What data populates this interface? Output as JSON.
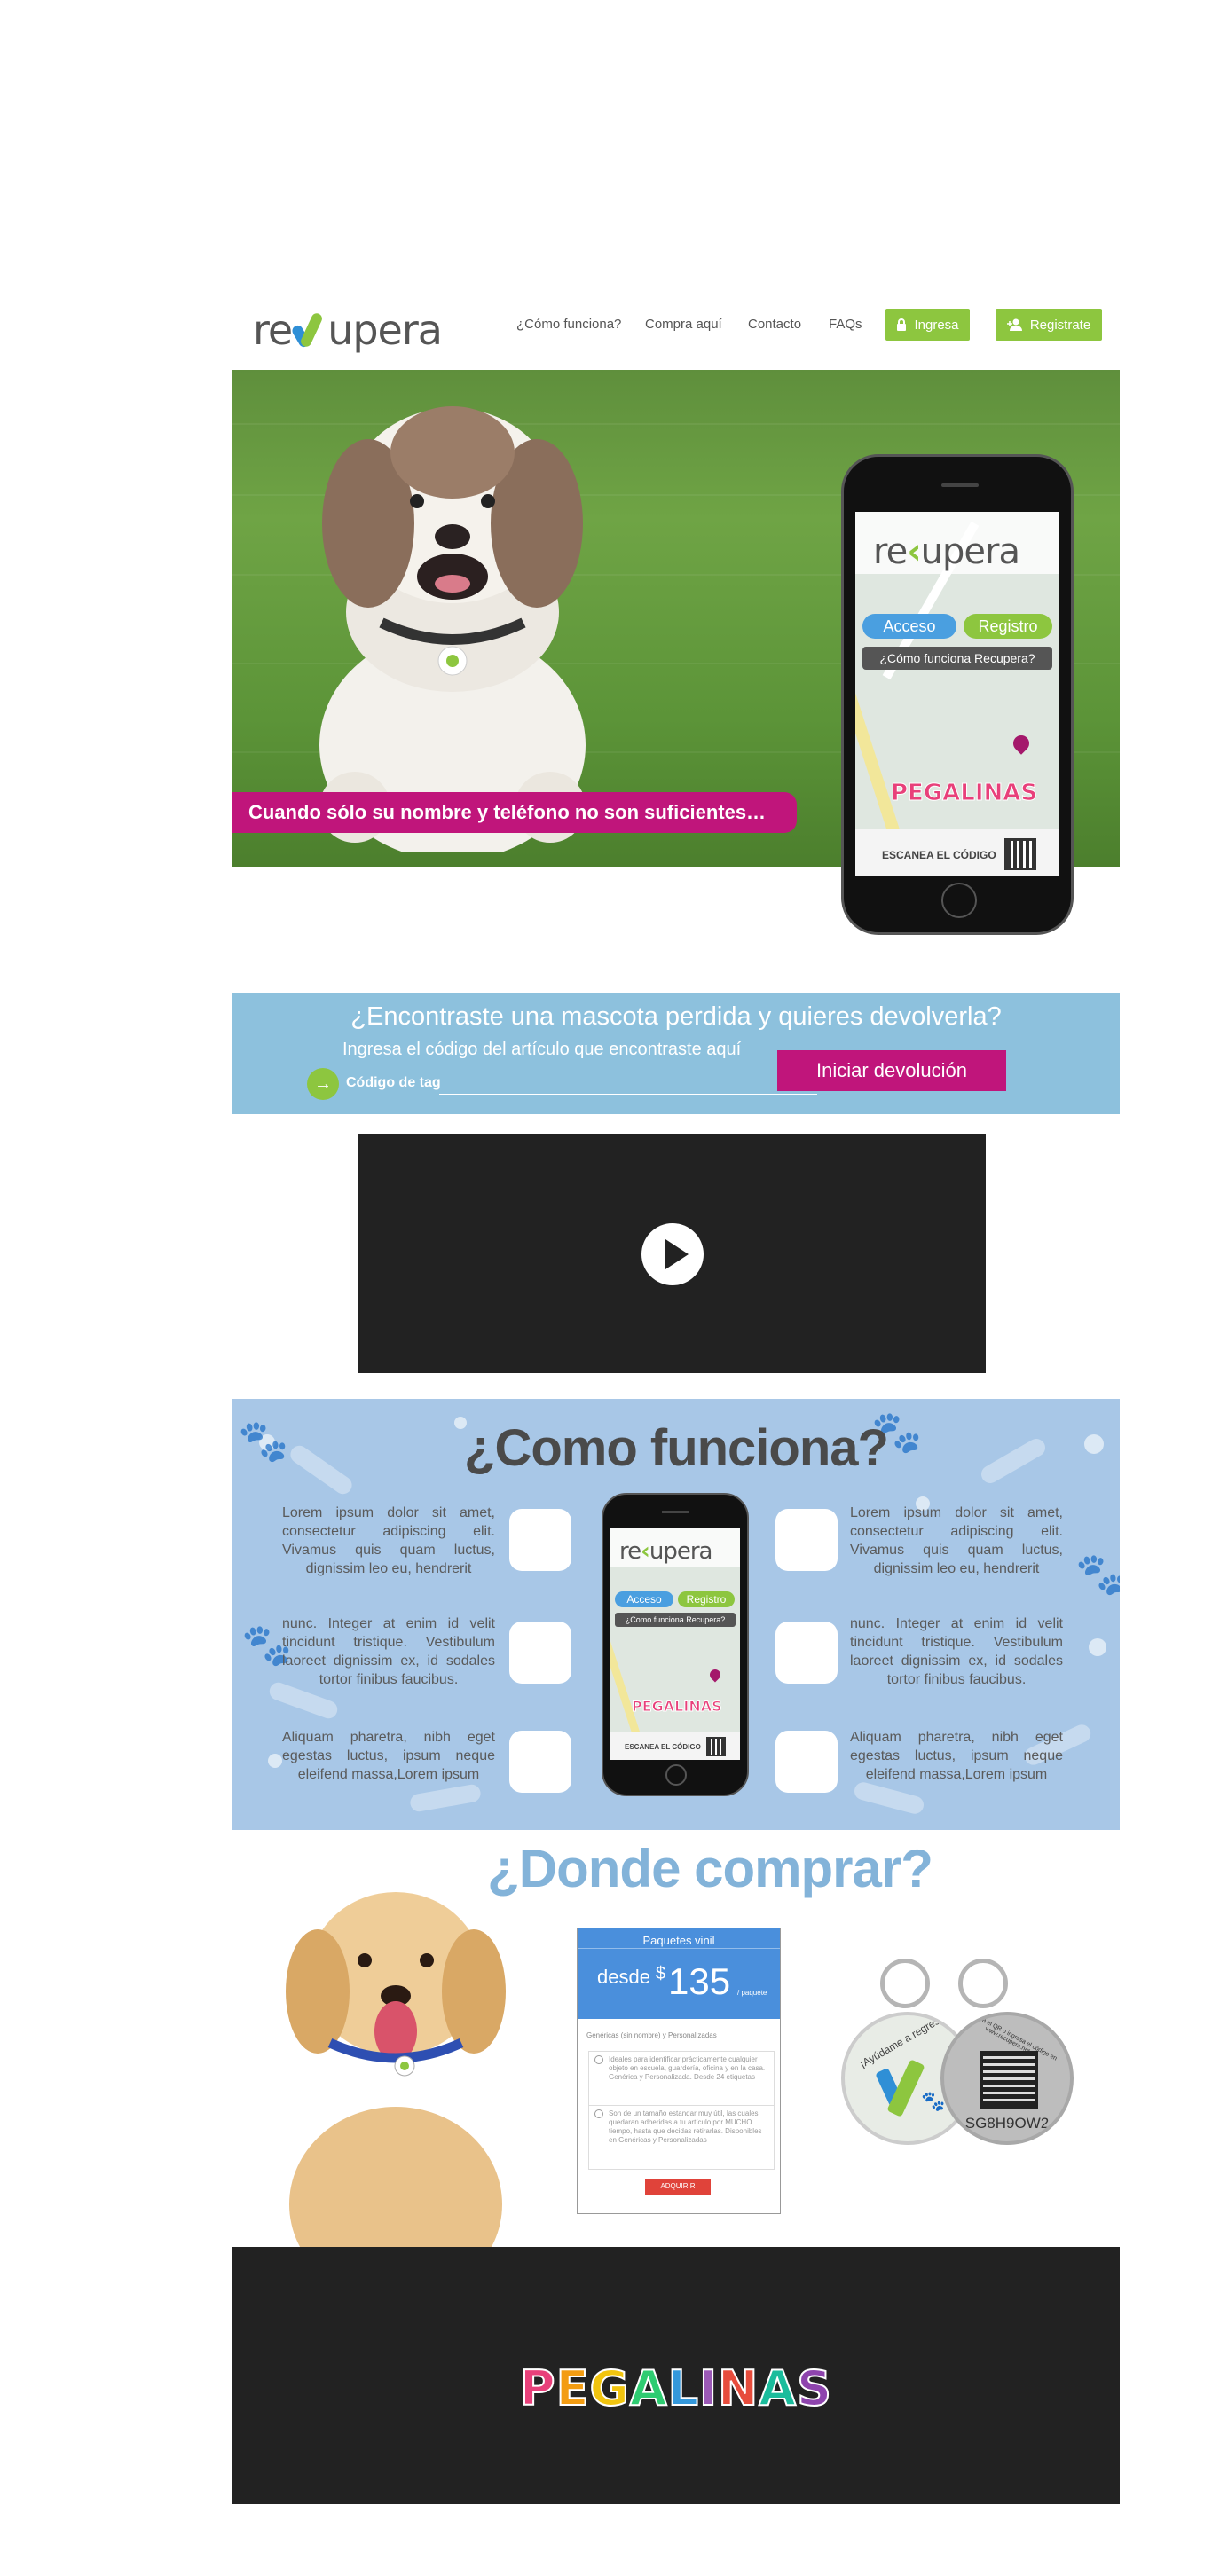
{
  "header": {
    "logo_text_left": "re",
    "logo_text_right": "upera",
    "nav": [
      {
        "label": "¿Cómo funciona?"
      },
      {
        "label": "Compra aquí"
      },
      {
        "label": "Contacto"
      },
      {
        "label": "FAQs"
      }
    ],
    "login_label": "Ingresa",
    "register_label": "Registrate"
  },
  "hero": {
    "slogan": "Cuando sólo su nombre y teléfono no son suficientes…",
    "phone": {
      "logo_left": "re",
      "logo_right": "upera",
      "access_label": "Acceso",
      "register_label": "Registro",
      "how_label": "¿Cómo funciona Recupera?",
      "brand": "PEGALINAS",
      "scan_label": "ESCANEA EL CÓDIGO"
    }
  },
  "lost": {
    "title": "¿Encontraste una mascota perdida y quieres devolverla?",
    "subtitle": "Ingresa el código del artículo que encontraste aquí",
    "code_label": "Código de tag",
    "code_value": "",
    "button_label": "Iniciar devolución"
  },
  "video": {
    "play_icon": "play-icon"
  },
  "how": {
    "title": "¿Como funciona?",
    "left": [
      "Lorem ipsum dolor sit amet, consectetur adipiscing elit. Vivamus quis quam luctus, dignissim leo eu, hendrerit",
      "nunc. Integer at enim id velit tincidunt tristique. Vestibulum laoreet dignissim ex, id sodales tortor finibus faucibus.",
      "Aliquam pharetra, nibh eget egestas luctus, ipsum neque eleifend massa,Lorem ipsum"
    ],
    "right": [
      "Lorem ipsum dolor sit amet, consectetur adipiscing elit. Vivamus quis quam luctus, dignissim leo eu, hendrerit",
      "nunc. Integer at enim id velit tincidunt tristique. Vestibulum laoreet dignissim ex, id sodales tortor finibus faucibus.",
      "Aliquam pharetra, nibh eget egestas luctus, ipsum neque eleifend massa,Lorem ipsum"
    ],
    "phone": {
      "logo_left": "re",
      "logo_right": "upera",
      "access_label": "Acceso",
      "register_label": "Registro",
      "how_label": "¿Como funciona Recupera?",
      "brand": "PEGALINAS",
      "scan_label": "ESCANEA EL CÓDIGO"
    }
  },
  "buy": {
    "title": "¿Donde comprar?",
    "card": {
      "header": "Paquetes vinil",
      "price_prefix": "desde",
      "currency": "$",
      "price": "135",
      "price_unit": "/ paquete",
      "subtitle": "Genéricas (sin nombre) y Personalizadas",
      "features": [
        "Ideales para identificar prácticamente cualquier objeto en escuela, guardería, oficina y en la casa. Genérica y Personalizada. Desde 24 etiquetas",
        "Son de un tamaño estandar muy útil, las cuales quedaran adheridas a tu artículo por MUCHO tiempo, hasta que decidas retirarlas. Disponibles en Genéricas y Personalizadas"
      ],
      "button_label": "ADQUIRIR"
    },
    "tag_left_text": "¡Ayúdame a regresar!",
    "tag_right_text": "Escanea el QR o ingresa el código en www.recupera.net",
    "tag_code": "SG8H9OW2"
  },
  "footer": {
    "brand_letters": [
      "P",
      "E",
      "G",
      "A",
      "L",
      "I",
      "N",
      "A",
      "S"
    ],
    "brand_colors": [
      "#e8407a",
      "#f39c12",
      "#f1c40f",
      "#2ecc71",
      "#3498db",
      "#9b59b6",
      "#e74c3c",
      "#1abc9c",
      "#8e44ad"
    ]
  },
  "colors": {
    "green": "#8dc63f",
    "magenta": "#c0157b",
    "blue_band": "#8dc1dd",
    "how_bg": "#a8c7e7",
    "title_blue": "#83b3d9"
  }
}
